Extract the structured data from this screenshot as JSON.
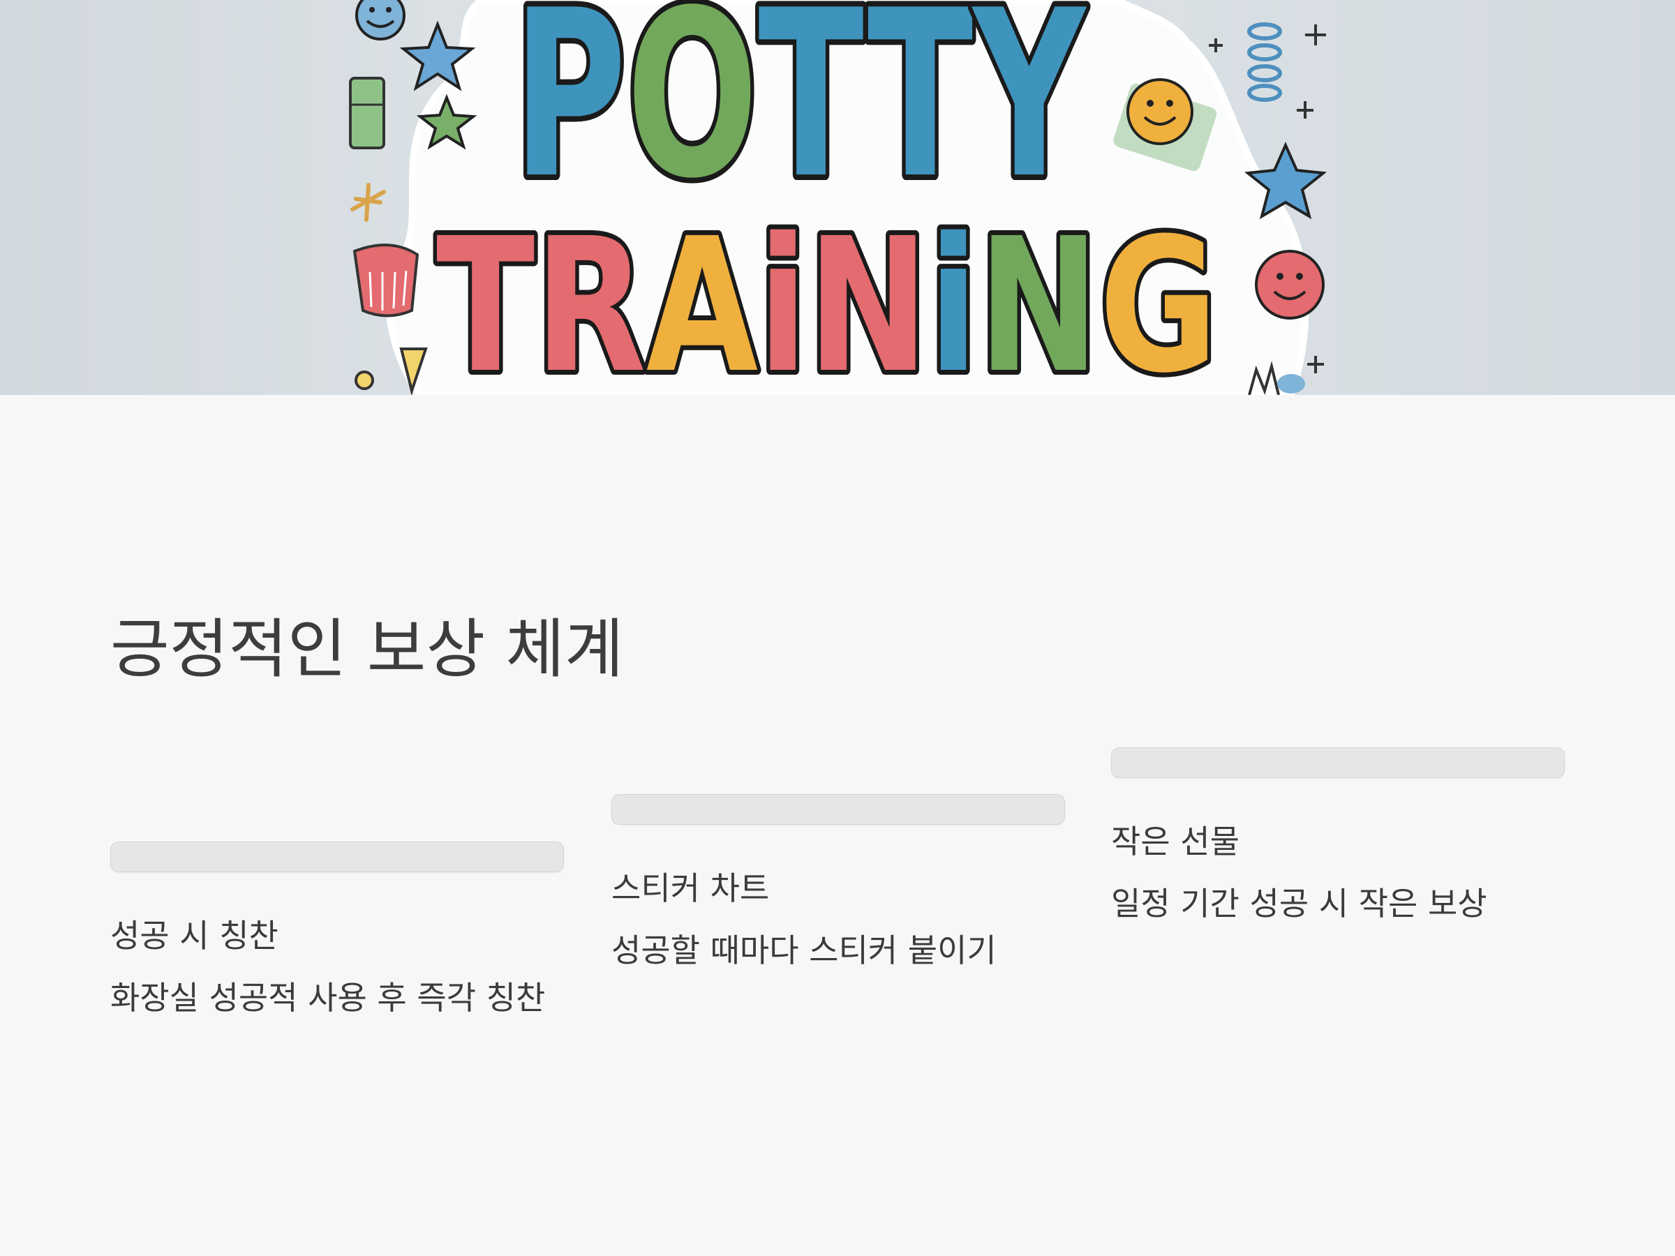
{
  "hero": {
    "line1": "POTTY",
    "line2": "TRAiNiNG",
    "line1_color": "#3f94bd",
    "line2_colors": [
      "#e46b6f",
      "#e46b6f",
      "#f0b03e",
      "#e46b6f",
      "#e46b6f",
      "#3f94bd",
      "#72a85b",
      "#f0b03e"
    ],
    "line1_colors": [
      "#3f94bd",
      "#72a85b",
      "#3f94bd",
      "#3f94bd",
      "#3f94bd"
    ]
  },
  "title": "긍정적인 보상 체계",
  "cards": [
    {
      "heading": "성공 시 칭찬",
      "text": "화장실 성공적 사용 후 즉각 칭찬"
    },
    {
      "heading": "스티커 차트",
      "text": "성공할 때마다 스티커 붙이기"
    },
    {
      "heading": "작은 선물",
      "text": "일정 기간 성공 시 작은 보상"
    }
  ],
  "colors": {
    "background": "#f7f7f7",
    "text": "#3a3a3a",
    "bar": "#e6e6e6"
  }
}
